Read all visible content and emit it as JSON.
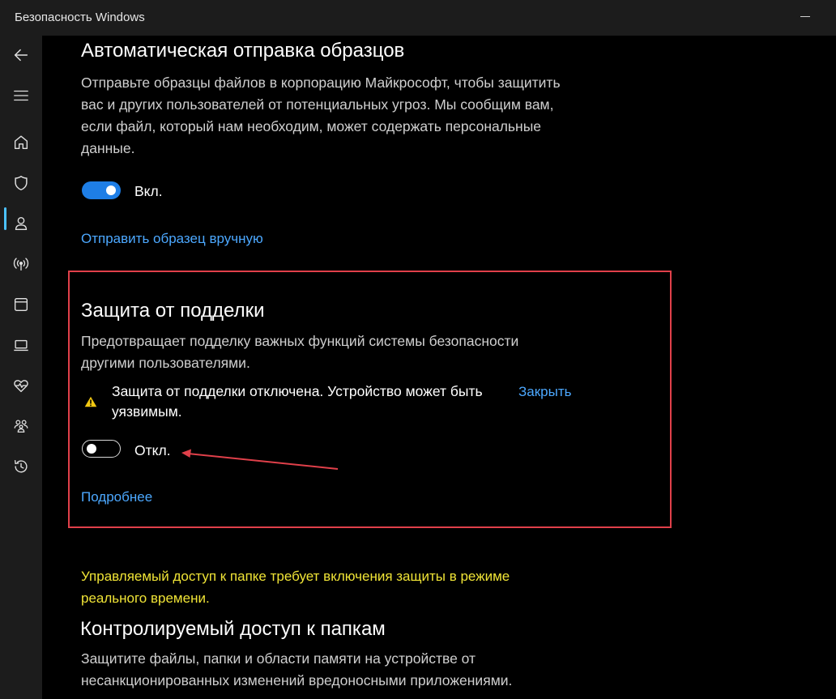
{
  "window": {
    "title": "Безопасность Windows"
  },
  "sidebar": {
    "items": [
      {
        "icon": "back-arrow-icon"
      },
      {
        "icon": "hamburger-menu-icon"
      },
      {
        "icon": "home-icon"
      },
      {
        "icon": "shield-icon",
        "active": true
      },
      {
        "icon": "account-icon"
      },
      {
        "icon": "network-antenna-icon"
      },
      {
        "icon": "app-browser-icon"
      },
      {
        "icon": "laptop-icon"
      },
      {
        "icon": "heart-pulse-icon"
      },
      {
        "icon": "family-icon"
      },
      {
        "icon": "history-icon"
      }
    ],
    "accent_color": "#4cc2ff"
  },
  "sample_submission": {
    "title": "Автоматическая отправка образцов",
    "description": "Отправьте образцы файлов в корпорацию Майкрософт, чтобы защитить вас и других пользователей от потенциальных угроз. Мы сообщим вам, если файл, который нам необходим, может содержать персональные данные.",
    "toggle_state": "on",
    "toggle_label": "Вкл.",
    "manual_link": "Отправить образец вручную"
  },
  "tamper_protection": {
    "title": "Защита от подделки",
    "description": "Предотвращает подделку важных функций системы безопасности другими пользователями.",
    "warning_text": "Защита от подделки отключена. Устройство может быть уязвимым.",
    "dismiss_link": "Закрыть",
    "toggle_state": "off",
    "toggle_label": "Откл.",
    "learn_more_link": "Подробнее",
    "highlight_color": "#e0404a"
  },
  "folder_access": {
    "warning": "Управляемый доступ к папке требует включения защиты в режиме реального времени.",
    "warning_color": "#f0e436",
    "title": "Контролируемый доступ к папкам",
    "description": "Защитите файлы, папки и области памяти на устройстве от несанкционированных изменений вредоносными приложениями."
  },
  "colors": {
    "link": "#4ca8ff",
    "toggle_on": "#1e7ee6"
  }
}
